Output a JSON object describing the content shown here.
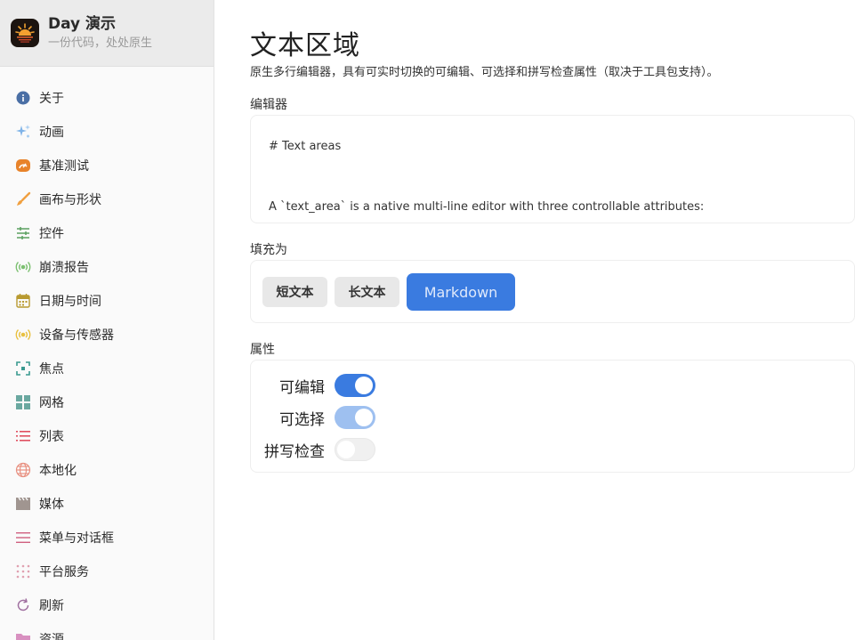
{
  "app": {
    "title": "Day 演示",
    "subtitle": "一份代码，处处原生"
  },
  "sidebar": {
    "items": [
      {
        "label": "关于",
        "icon": "info-icon",
        "color": "#4a6fa5"
      },
      {
        "label": "动画",
        "icon": "sparkles-icon",
        "color": "#7fb3e8"
      },
      {
        "label": "基准测试",
        "icon": "gauge-icon",
        "color": "#e8832a"
      },
      {
        "label": "画布与形状",
        "icon": "paintbrush-icon",
        "color": "#f0a040"
      },
      {
        "label": "控件",
        "icon": "sliders-icon",
        "color": "#5aa060"
      },
      {
        "label": "崩溃报告",
        "icon": "broadcast-icon",
        "color": "#7cc070"
      },
      {
        "label": "日期与时间",
        "icon": "calendar-icon",
        "color": "#b89a30"
      },
      {
        "label": "设备与传感器",
        "icon": "sensor-icon",
        "color": "#e8c040"
      },
      {
        "label": "焦点",
        "icon": "focus-icon",
        "color": "#3a9a90"
      },
      {
        "label": "网格",
        "icon": "grid-icon",
        "color": "#6aa8a0"
      },
      {
        "label": "列表",
        "icon": "list-icon",
        "color": "#e05060"
      },
      {
        "label": "本地化",
        "icon": "globe-icon",
        "color": "#e89080"
      },
      {
        "label": "媒体",
        "icon": "film-icon",
        "color": "#a09590"
      },
      {
        "label": "菜单与对话框",
        "icon": "menu-icon",
        "color": "#d06080"
      },
      {
        "label": "平台服务",
        "icon": "dots-grid-icon",
        "color": "#e0a0b0"
      },
      {
        "label": "刷新",
        "icon": "refresh-icon",
        "color": "#a070a0"
      },
      {
        "label": "资源",
        "icon": "folder-icon",
        "color": "#d890c0"
      }
    ]
  },
  "page": {
    "title": "文本区域",
    "description": "原生多行编辑器，具有可实时切换的可编辑、可选择和拼写检查属性（取决于工具包支持）。"
  },
  "editor": {
    "label": "编辑器",
    "content": "# Text areas\n\nA `text_area` is a native multi-line editor with three controllable attributes:\n\n- **editable** — read-only when off\n- **selectable** — text selection toggle"
  },
  "fill": {
    "label": "填充为",
    "buttons": [
      "短文本",
      "长文本",
      "Markdown"
    ]
  },
  "props": {
    "label": "属性",
    "items": [
      {
        "label": "可编辑",
        "state": "on"
      },
      {
        "label": "可选择",
        "state": "on-disabled"
      },
      {
        "label": "拼写检查",
        "state": "off"
      }
    ]
  },
  "colors": {
    "accent": "#3a7be0",
    "accent_dim": "#9ec0f0"
  }
}
